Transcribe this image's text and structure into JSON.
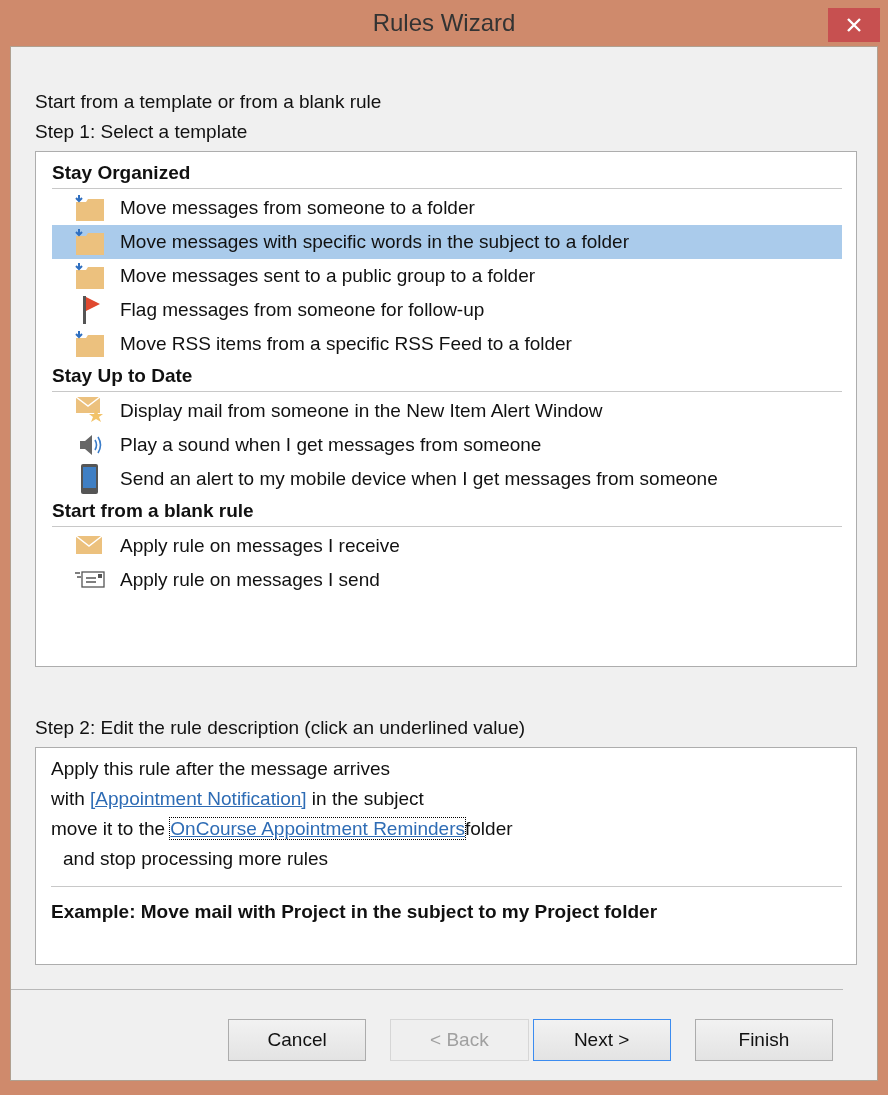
{
  "window": {
    "title": "Rules Wizard"
  },
  "intro": "Start from a template or from a blank rule",
  "step1": {
    "label": "Step 1: Select a template",
    "groups": [
      {
        "heading": "Stay Organized",
        "items": [
          {
            "label": "Move messages from someone to a folder",
            "kind": "move",
            "selected": false
          },
          {
            "label": "Move messages with specific words in the subject to a folder",
            "kind": "move",
            "selected": true
          },
          {
            "label": "Move messages sent to a public group to a folder",
            "kind": "move",
            "selected": false
          },
          {
            "label": "Flag messages from someone for follow-up",
            "kind": "flag",
            "selected": false
          },
          {
            "label": "Move RSS items from a specific RSS Feed to a folder",
            "kind": "move",
            "selected": false
          }
        ]
      },
      {
        "heading": "Stay Up to Date",
        "items": [
          {
            "label": "Display mail from someone in the New Item Alert Window",
            "kind": "alert",
            "selected": false
          },
          {
            "label": "Play a sound when I get messages from someone",
            "kind": "sound",
            "selected": false
          },
          {
            "label": "Send an alert to my mobile device when I get messages from someone",
            "kind": "mobile",
            "selected": false
          }
        ]
      },
      {
        "heading": "Start from a blank rule",
        "items": [
          {
            "label": "Apply rule on messages I receive",
            "kind": "receive",
            "selected": false
          },
          {
            "label": "Apply rule on messages I send",
            "kind": "send",
            "selected": false
          }
        ]
      }
    ]
  },
  "step2": {
    "label": "Step 2: Edit the rule description (click an underlined value)",
    "lines": [
      {
        "indent": false,
        "parts": [
          {
            "kind": "text",
            "text": "Apply this rule after the message arrives"
          }
        ]
      },
      {
        "indent": false,
        "parts": [
          {
            "kind": "text",
            "text": "with "
          },
          {
            "kind": "link",
            "text": "[Appointment Notification]",
            "focused": false
          },
          {
            "kind": "text",
            "text": " in the subject"
          }
        ]
      },
      {
        "indent": false,
        "parts": [
          {
            "kind": "text",
            "text": "move it to the "
          },
          {
            "kind": "link",
            "text": "OnCourse Appointment Reminders",
            "focused": true
          },
          {
            "kind": "text",
            "text": "folder"
          }
        ]
      },
      {
        "indent": true,
        "parts": [
          {
            "kind": "text",
            "text": "and stop processing more rules"
          }
        ]
      }
    ],
    "example": "Example: Move mail with Project in the subject to my Project folder"
  },
  "buttons": [
    {
      "label": "Cancel",
      "disabled": false,
      "default": false
    },
    {
      "label": "< Back",
      "disabled": true,
      "default": false
    },
    {
      "label": "Next >",
      "disabled": false,
      "default": true
    },
    {
      "label": "Finish",
      "disabled": false,
      "default": false
    }
  ]
}
